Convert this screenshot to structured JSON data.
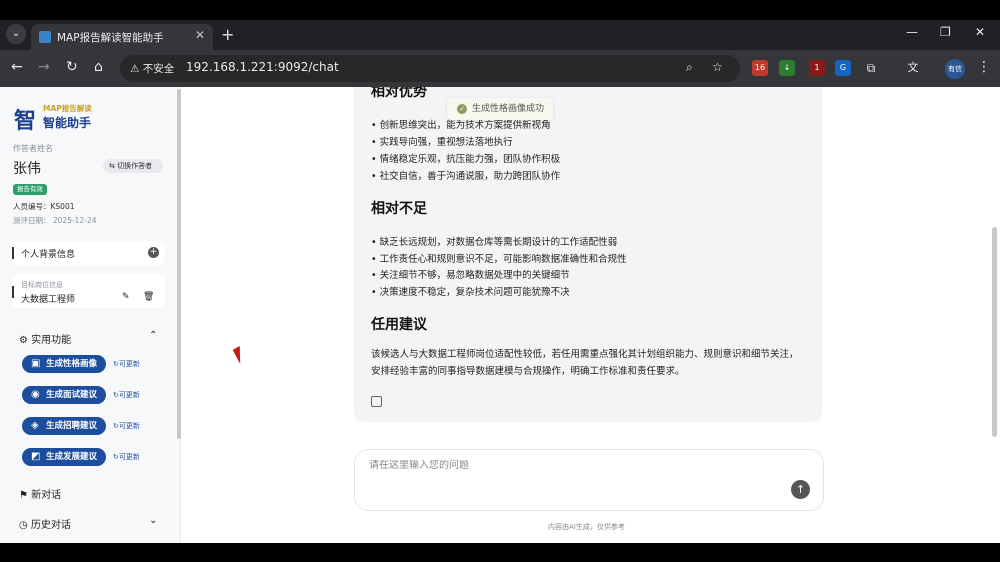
{
  "browser": {
    "tab_title": "MAP报告解读智能助手",
    "tab_close": "✕",
    "new_tab": "+",
    "security": "⚠ 不安全",
    "url": "192.168.1.221:9092/chat",
    "ext_badge_1": "16",
    "ext_badge_2": "1",
    "profile_label": "有信"
  },
  "sidebar": {
    "logo_mark": "智",
    "logo_sub": "MAP报告解读",
    "logo_title": "智能助手",
    "respondent_label": "作答者姓名",
    "respondent_name": "张伟",
    "switch_label": "切换作答者",
    "report_badge": "报告有效",
    "person_id": "人员编号：KS001",
    "eval_date": "测评日期：  2025-12-24",
    "background_label": "个人背景信息",
    "target_label": "目标岗位信息",
    "target_value": "大数据工程师",
    "features_label": "实用功能",
    "actions": [
      {
        "label": "生成性格画像",
        "refresh": "可更新"
      },
      {
        "label": "生成面试建议",
        "refresh": "可更新"
      },
      {
        "label": "生成招聘建议",
        "refresh": "可更新"
      },
      {
        "label": "生成发展建议",
        "refresh": "可更新"
      }
    ],
    "new_chat": "新对话",
    "history": "历史对话"
  },
  "chat": {
    "toast": "生成性格画像成功",
    "heading_strengths": "相对优势",
    "strengths": [
      "• 创新思维突出，能为技术方案提供新视角",
      "• 实践导向强，重视想法落地执行",
      "• 情绪稳定乐观，抗压能力强，团队协作积极",
      "• 社交自信，善于沟通说服，助力跨团队协作"
    ],
    "heading_weaknesses": "相对不足",
    "weaknesses": [
      "• 缺乏长远规划，对数据仓库等需长期设计的工作适配性弱",
      "• 工作责任心和规则意识不足，可能影响数据准确性和合规性",
      "• 关注细节不够，易忽略数据处理中的关键细节",
      "• 决策速度不稳定，复杂技术问题可能犹豫不决"
    ],
    "heading_advice": "任用建议",
    "advice": "该候选人与大数据工程师岗位适配性较低，若任用需重点强化其计划组织能力、规则意识和细节关注，安排经验丰富的同事指导数据建模与合规操作，明确工作标准和责任要求。",
    "input_placeholder": "请在这里输入您的问题",
    "footnote": "内容由AI生成，仅供参考"
  }
}
